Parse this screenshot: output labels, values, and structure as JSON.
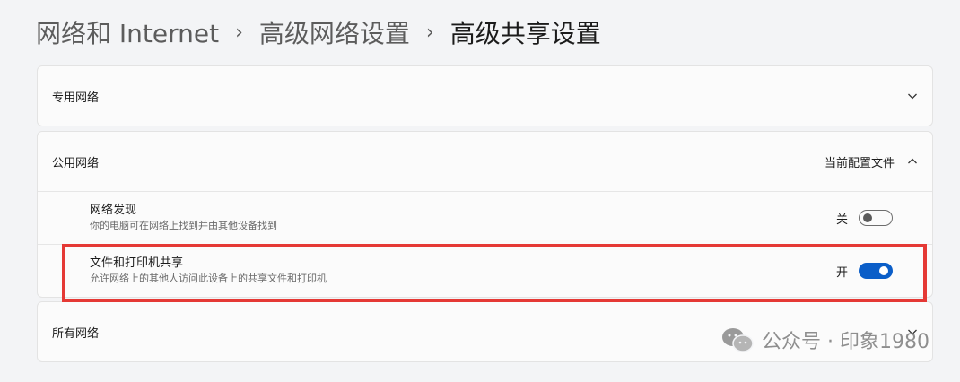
{
  "breadcrumb": {
    "items": [
      "网络和 Internet",
      "高级网络设置",
      "高级共享设置"
    ],
    "separator": "›"
  },
  "private_network": {
    "label": "专用网络",
    "expanded": false
  },
  "public_network": {
    "label": "公用网络",
    "tag": "当前配置文件",
    "expanded": true,
    "settings": [
      {
        "title": "网络发现",
        "description": "你的电脑可在网络上找到并由其他设备找到",
        "state_label": "关",
        "on": false
      },
      {
        "title": "文件和打印机共享",
        "description": "允许网络上的其他人访问此设备上的共享文件和打印机",
        "state_label": "开",
        "on": true
      }
    ]
  },
  "all_networks": {
    "label": "所有网络",
    "expanded": false
  },
  "watermark": {
    "text": "公众号 · 印象1980"
  },
  "colors": {
    "accent": "#0b5ec8",
    "highlight_border": "#e53935",
    "background": "#f3f4f6",
    "card": "#fbfbfb"
  }
}
